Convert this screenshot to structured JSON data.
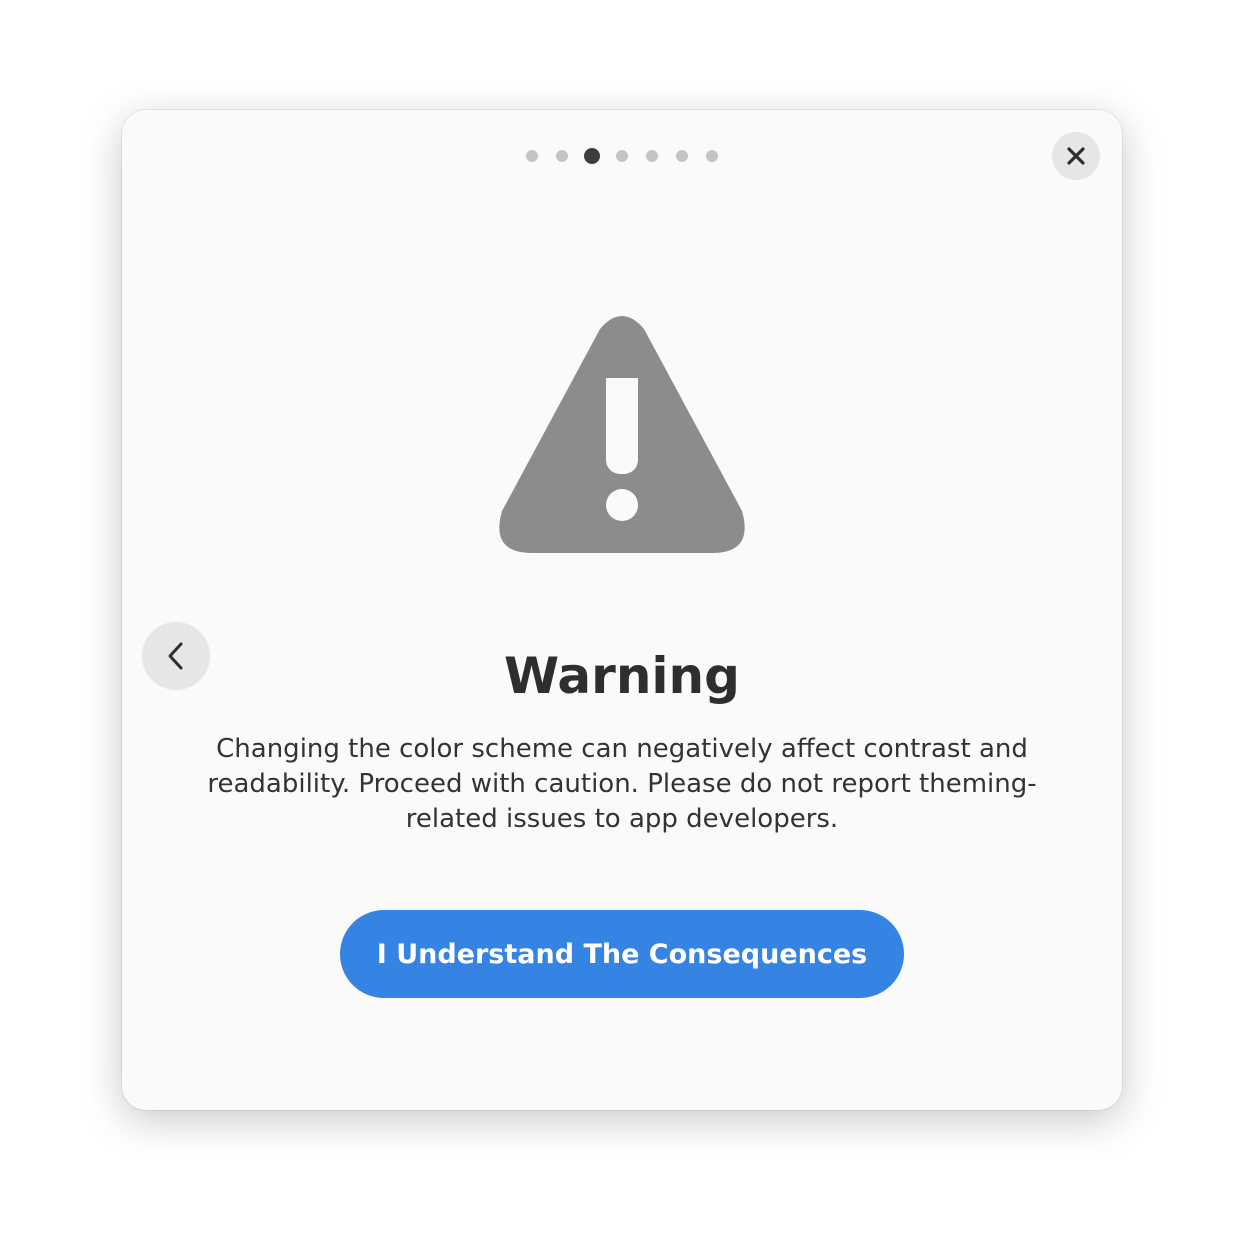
{
  "pager": {
    "total": 7,
    "current_index": 2
  },
  "icons": {
    "close": "close-icon",
    "back": "chevron-left-icon",
    "warning": "warning-triangle-icon"
  },
  "content": {
    "title": "Warning",
    "body": "Changing the color scheme can negatively affect contrast and readability. Proceed with caution. Please do not report theming-related issues to app developers."
  },
  "actions": {
    "confirm_label": "I Understand The Consequences"
  },
  "colors": {
    "accent": "#3584e4",
    "dialog_bg": "#fafafa",
    "icon_gray": "#8c8c8c",
    "dot_active": "#3d3d3d",
    "dot_inactive": "#c4c4c4"
  }
}
